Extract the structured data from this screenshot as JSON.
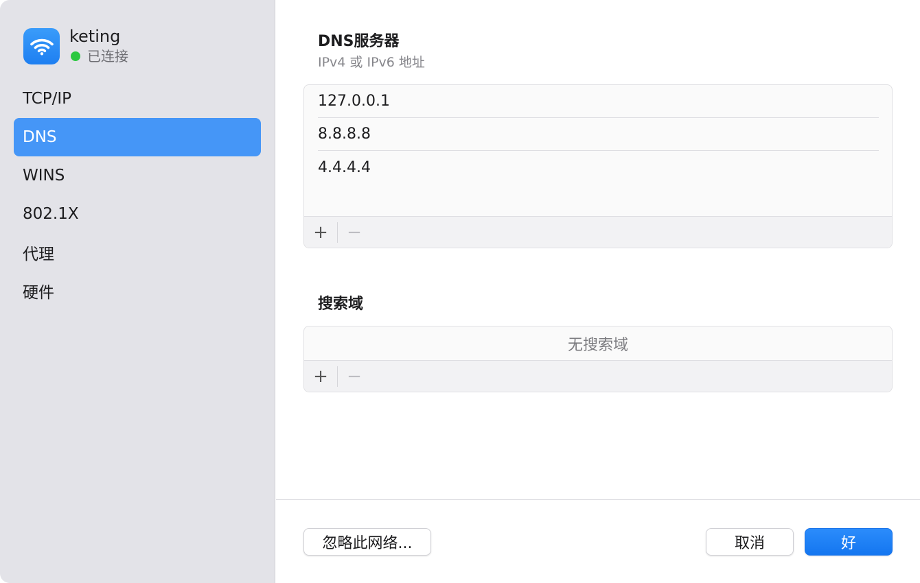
{
  "network": {
    "name": "keting",
    "status": "已连接",
    "status_color": "#2bc840",
    "icon": "wifi-icon"
  },
  "sidebar": {
    "items": [
      {
        "label": "TCP/IP",
        "active": false
      },
      {
        "label": "DNS",
        "active": true
      },
      {
        "label": "WINS",
        "active": false
      },
      {
        "label": "802.1X",
        "active": false
      },
      {
        "label": "代理",
        "active": false
      },
      {
        "label": "硬件",
        "active": false
      }
    ],
    "active_color": "#4596f7"
  },
  "dns": {
    "title": "DNS服务器",
    "subtitle": "IPv4 或 IPv6 地址",
    "servers": [
      "127.0.0.1",
      "8.8.8.8",
      "4.4.4.4"
    ],
    "add_label": "+",
    "remove_label": "−"
  },
  "search_domains": {
    "title": "搜索域",
    "empty_text": "无搜索域",
    "add_label": "+",
    "remove_label": "−"
  },
  "footer": {
    "forget_label": "忽略此网络...",
    "cancel_label": "取消",
    "ok_label": "好"
  },
  "accent_color": "#1e7ff1"
}
